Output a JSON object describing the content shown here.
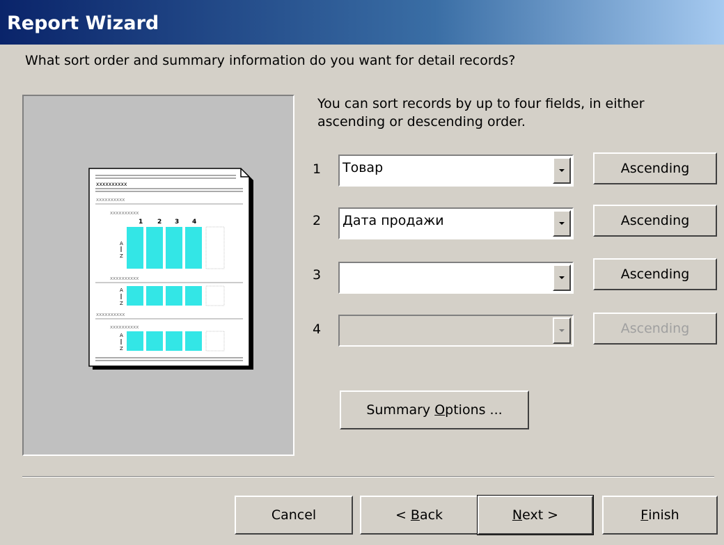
{
  "window": {
    "title": "Report Wizard"
  },
  "question": "What sort order and summary information do you want for detail records?",
  "instructions": "You can sort records by up to four fields, in either ascending or descending order.",
  "sort_rows": [
    {
      "number": "1",
      "field": "Товар",
      "order": "Ascending",
      "enabled": true
    },
    {
      "number": "2",
      "field": "Дата продажи",
      "order": "Ascending",
      "enabled": true
    },
    {
      "number": "3",
      "field": "",
      "order": "Ascending",
      "enabled": true
    },
    {
      "number": "4",
      "field": "",
      "order": "Ascending",
      "enabled": false
    }
  ],
  "summary_button": {
    "before": "Summary ",
    "mnemonic": "O",
    "after": "ptions ..."
  },
  "footer": {
    "cancel": "Cancel",
    "back": {
      "before": "< ",
      "mnemonic": "B",
      "after": "ack"
    },
    "next": {
      "mnemonic": "N",
      "after": "ext >"
    },
    "finish": {
      "mnemonic": "F",
      "after": "inish"
    }
  },
  "preview": {
    "placeholder": "xxxxxxxxxx",
    "cell_text": "xxxx",
    "column_numbers": [
      "1",
      "2",
      "3",
      "4"
    ],
    "sort_glyph_top": "A",
    "sort_glyph_bottom": "Z",
    "colors": {
      "page": "#ffffff",
      "highlight": "#33e6e6",
      "placeholder": "#808080"
    }
  }
}
